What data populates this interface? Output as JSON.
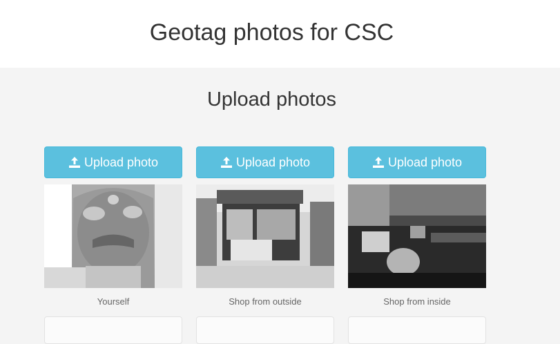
{
  "header": {
    "title": "Geotag photos for CSC"
  },
  "main": {
    "section_title": "Upload photos",
    "cards": [
      {
        "button_label": "Upload photo",
        "caption": "Yourself",
        "photo_subject": "portrait of person"
      },
      {
        "button_label": "Upload photo",
        "caption": "Shop from outside",
        "photo_subject": "shop exterior"
      },
      {
        "button_label": "Upload photo",
        "caption": "Shop from inside",
        "photo_subject": "shop interior with computers"
      }
    ]
  },
  "colors": {
    "button": "#5bc0de",
    "button_border": "#46b8da",
    "header_bg": "#ffffff",
    "page_bg": "#f4f4f4"
  },
  "icons": {
    "upload": "upload-icon"
  }
}
